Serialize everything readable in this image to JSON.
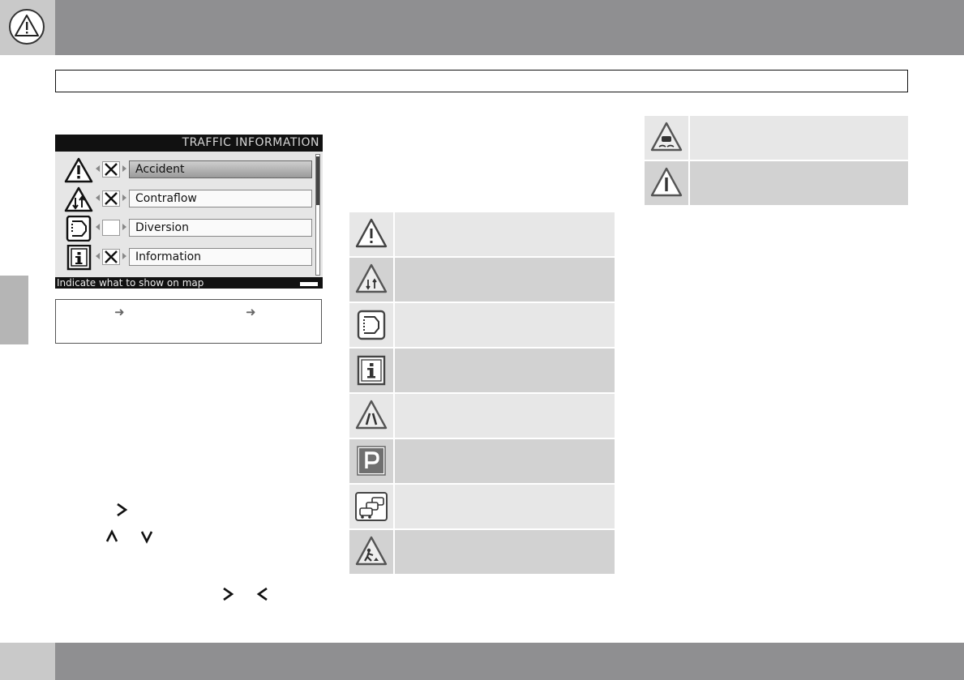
{
  "screen": {
    "title": "TRAFFIC INFORMATION",
    "items": [
      {
        "label": "Accident",
        "checked": true,
        "icon": "accident-warning-icon"
      },
      {
        "label": "Contraflow",
        "checked": true,
        "icon": "contraflow-icon"
      },
      {
        "label": "Diversion",
        "checked": false,
        "icon": "diversion-icon"
      },
      {
        "label": "Information",
        "checked": true,
        "icon": "information-icon"
      }
    ],
    "status_text": "Indicate what to show on map"
  },
  "symbols": [
    "accident-warning-icon",
    "contraflow-icon",
    "diversion-icon",
    "information-icon",
    "road-narrows-icon",
    "parking-icon",
    "traffic-queue-icon",
    "roadworks-icon",
    "slippery-road-icon",
    "danger-warning-icon"
  ]
}
